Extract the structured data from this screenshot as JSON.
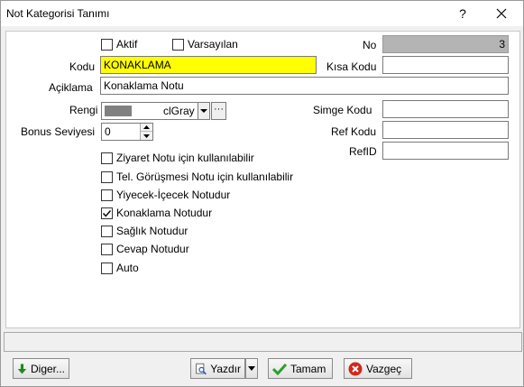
{
  "window": {
    "title": "Not Kategorisi Tanımı",
    "help_label": "?"
  },
  "form": {
    "aktif": {
      "label": "Aktif",
      "checked": false
    },
    "varsayilan": {
      "label": "Varsayılan",
      "checked": false
    },
    "no": {
      "label": "No",
      "value": "3"
    },
    "kodu": {
      "label": "Kodu",
      "value": "KONAKLAMA"
    },
    "kisa_kodu": {
      "label": "Kısa Kodu",
      "value": ""
    },
    "aciklama": {
      "label": "Açiklama",
      "value": "Konaklama Notu"
    },
    "rengi": {
      "label": "Rengi",
      "value": "clGray",
      "swatch_color": "#808080",
      "more_label": "···"
    },
    "simge_kodu": {
      "label": "Simge Kodu",
      "value": ""
    },
    "bonus_seviyesi": {
      "label": "Bonus Seviyesi",
      "value": "0"
    },
    "ref_kodu": {
      "label": "Ref Kodu",
      "value": ""
    },
    "ref_id": {
      "label": "RefID",
      "value": ""
    },
    "options": [
      {
        "label": "Ziyaret Notu için kullanılabilir",
        "checked": false
      },
      {
        "label": "Tel. Görüşmesi Notu için kullanılabilir",
        "checked": false
      },
      {
        "label": "Yiyecek-İçecek Notudur",
        "checked": false
      },
      {
        "label": "Konaklama Notudur",
        "checked": true
      },
      {
        "label": "Sağlık Notudur",
        "checked": false
      },
      {
        "label": "Cevap Notudur",
        "checked": false
      },
      {
        "label": "Auto",
        "checked": false
      }
    ]
  },
  "status_bar": {
    "text": ""
  },
  "buttons": {
    "diger": "Diger...",
    "yazdir": "Yazdır",
    "tamam": "Tamam",
    "vazgec": "Vazgeç"
  },
  "colors": {
    "highlight_field": "#ffff00",
    "readonly_field": "#b4b4b4",
    "ok_icon": "#2e9e2e",
    "cancel_icon": "#d0281c",
    "down_icon": "#1e8a1e"
  },
  "icons": [
    "close-icon",
    "chevron-down-icon",
    "arrow-down-icon",
    "print-preview-icon",
    "checkmark-icon",
    "cancel-icon"
  ]
}
